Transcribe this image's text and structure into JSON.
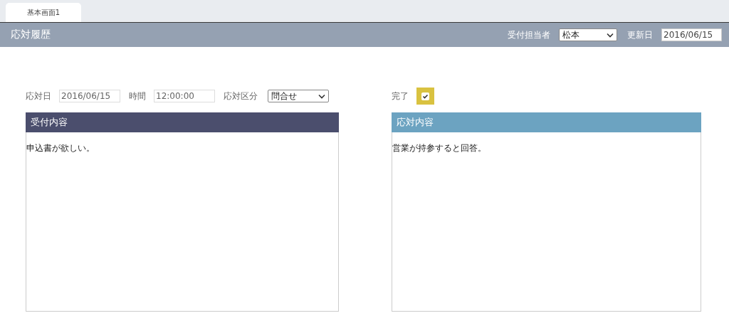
{
  "tabs": [
    {
      "label": "基本画面1",
      "selected": true
    }
  ],
  "header": {
    "title": "応対履歴",
    "assignee": {
      "label": "受付担当者",
      "value": "松本"
    },
    "updated": {
      "label": "更新日",
      "value": "2016/06/15"
    }
  },
  "form": {
    "date": {
      "label": "応対日",
      "value": "2016/06/15"
    },
    "time": {
      "label": "時間",
      "value": "12:00:00"
    },
    "category": {
      "label": "応対区分",
      "value": "問合せ"
    },
    "done": {
      "label": "完了",
      "checked": true
    }
  },
  "panels": [
    {
      "title": "受付内容",
      "text": "申込書が欲しい。",
      "color": "#4b4e6d"
    },
    {
      "title": "応対内容",
      "text": "営業が持参すると回答。",
      "color": "#6ca3c1"
    }
  ]
}
